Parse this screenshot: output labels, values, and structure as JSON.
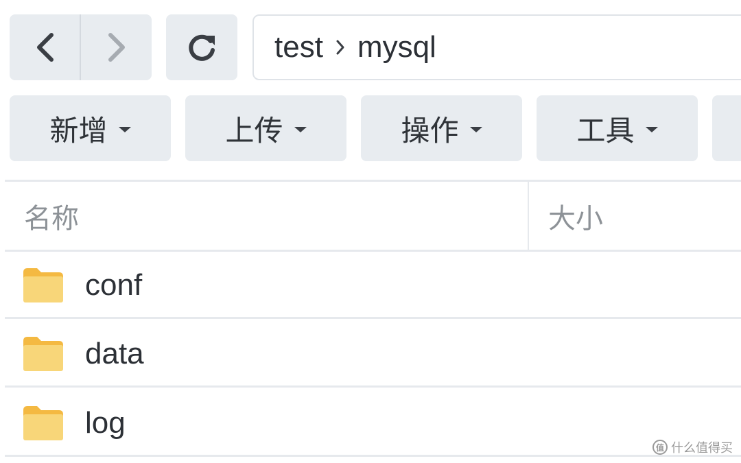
{
  "toolbar": {
    "breadcrumb": [
      "test",
      "mysql"
    ],
    "menus": [
      "新增",
      "上传",
      "操作",
      "工具"
    ]
  },
  "table": {
    "columns": [
      "名称",
      "大小"
    ],
    "rows": [
      {
        "name": "conf",
        "icon": "folder-icon"
      },
      {
        "name": "data",
        "icon": "folder-icon"
      },
      {
        "name": "log",
        "icon": "folder-icon"
      }
    ]
  },
  "watermark": {
    "text": "什么值得买",
    "logo_text": "值"
  },
  "colors": {
    "button_bg": "#e8ecf0",
    "folder_fill": "#f8d679",
    "folder_tab": "#f4b942",
    "divider": "#e6e9ed"
  }
}
